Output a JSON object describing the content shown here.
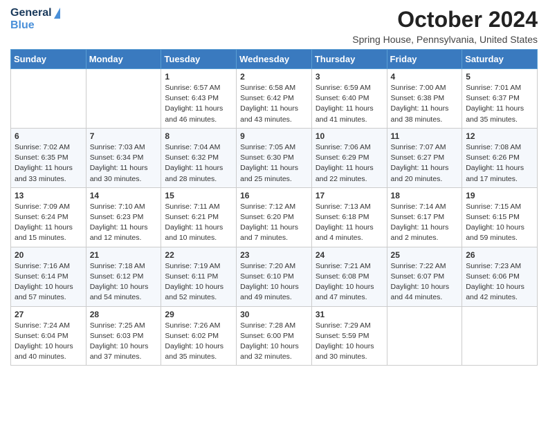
{
  "header": {
    "logo_line1": "General",
    "logo_line2": "Blue",
    "month_title": "October 2024",
    "subtitle": "Spring House, Pennsylvania, United States"
  },
  "days_of_week": [
    "Sunday",
    "Monday",
    "Tuesday",
    "Wednesday",
    "Thursday",
    "Friday",
    "Saturday"
  ],
  "weeks": [
    [
      {
        "day": "",
        "info": ""
      },
      {
        "day": "",
        "info": ""
      },
      {
        "day": "1",
        "info": "Sunrise: 6:57 AM\nSunset: 6:43 PM\nDaylight: 11 hours and 46 minutes."
      },
      {
        "day": "2",
        "info": "Sunrise: 6:58 AM\nSunset: 6:42 PM\nDaylight: 11 hours and 43 minutes."
      },
      {
        "day": "3",
        "info": "Sunrise: 6:59 AM\nSunset: 6:40 PM\nDaylight: 11 hours and 41 minutes."
      },
      {
        "day": "4",
        "info": "Sunrise: 7:00 AM\nSunset: 6:38 PM\nDaylight: 11 hours and 38 minutes."
      },
      {
        "day": "5",
        "info": "Sunrise: 7:01 AM\nSunset: 6:37 PM\nDaylight: 11 hours and 35 minutes."
      }
    ],
    [
      {
        "day": "6",
        "info": "Sunrise: 7:02 AM\nSunset: 6:35 PM\nDaylight: 11 hours and 33 minutes."
      },
      {
        "day": "7",
        "info": "Sunrise: 7:03 AM\nSunset: 6:34 PM\nDaylight: 11 hours and 30 minutes."
      },
      {
        "day": "8",
        "info": "Sunrise: 7:04 AM\nSunset: 6:32 PM\nDaylight: 11 hours and 28 minutes."
      },
      {
        "day": "9",
        "info": "Sunrise: 7:05 AM\nSunset: 6:30 PM\nDaylight: 11 hours and 25 minutes."
      },
      {
        "day": "10",
        "info": "Sunrise: 7:06 AM\nSunset: 6:29 PM\nDaylight: 11 hours and 22 minutes."
      },
      {
        "day": "11",
        "info": "Sunrise: 7:07 AM\nSunset: 6:27 PM\nDaylight: 11 hours and 20 minutes."
      },
      {
        "day": "12",
        "info": "Sunrise: 7:08 AM\nSunset: 6:26 PM\nDaylight: 11 hours and 17 minutes."
      }
    ],
    [
      {
        "day": "13",
        "info": "Sunrise: 7:09 AM\nSunset: 6:24 PM\nDaylight: 11 hours and 15 minutes."
      },
      {
        "day": "14",
        "info": "Sunrise: 7:10 AM\nSunset: 6:23 PM\nDaylight: 11 hours and 12 minutes."
      },
      {
        "day": "15",
        "info": "Sunrise: 7:11 AM\nSunset: 6:21 PM\nDaylight: 11 hours and 10 minutes."
      },
      {
        "day": "16",
        "info": "Sunrise: 7:12 AM\nSunset: 6:20 PM\nDaylight: 11 hours and 7 minutes."
      },
      {
        "day": "17",
        "info": "Sunrise: 7:13 AM\nSunset: 6:18 PM\nDaylight: 11 hours and 4 minutes."
      },
      {
        "day": "18",
        "info": "Sunrise: 7:14 AM\nSunset: 6:17 PM\nDaylight: 11 hours and 2 minutes."
      },
      {
        "day": "19",
        "info": "Sunrise: 7:15 AM\nSunset: 6:15 PM\nDaylight: 10 hours and 59 minutes."
      }
    ],
    [
      {
        "day": "20",
        "info": "Sunrise: 7:16 AM\nSunset: 6:14 PM\nDaylight: 10 hours and 57 minutes."
      },
      {
        "day": "21",
        "info": "Sunrise: 7:18 AM\nSunset: 6:12 PM\nDaylight: 10 hours and 54 minutes."
      },
      {
        "day": "22",
        "info": "Sunrise: 7:19 AM\nSunset: 6:11 PM\nDaylight: 10 hours and 52 minutes."
      },
      {
        "day": "23",
        "info": "Sunrise: 7:20 AM\nSunset: 6:10 PM\nDaylight: 10 hours and 49 minutes."
      },
      {
        "day": "24",
        "info": "Sunrise: 7:21 AM\nSunset: 6:08 PM\nDaylight: 10 hours and 47 minutes."
      },
      {
        "day": "25",
        "info": "Sunrise: 7:22 AM\nSunset: 6:07 PM\nDaylight: 10 hours and 44 minutes."
      },
      {
        "day": "26",
        "info": "Sunrise: 7:23 AM\nSunset: 6:06 PM\nDaylight: 10 hours and 42 minutes."
      }
    ],
    [
      {
        "day": "27",
        "info": "Sunrise: 7:24 AM\nSunset: 6:04 PM\nDaylight: 10 hours and 40 minutes."
      },
      {
        "day": "28",
        "info": "Sunrise: 7:25 AM\nSunset: 6:03 PM\nDaylight: 10 hours and 37 minutes."
      },
      {
        "day": "29",
        "info": "Sunrise: 7:26 AM\nSunset: 6:02 PM\nDaylight: 10 hours and 35 minutes."
      },
      {
        "day": "30",
        "info": "Sunrise: 7:28 AM\nSunset: 6:00 PM\nDaylight: 10 hours and 32 minutes."
      },
      {
        "day": "31",
        "info": "Sunrise: 7:29 AM\nSunset: 5:59 PM\nDaylight: 10 hours and 30 minutes."
      },
      {
        "day": "",
        "info": ""
      },
      {
        "day": "",
        "info": ""
      }
    ]
  ]
}
